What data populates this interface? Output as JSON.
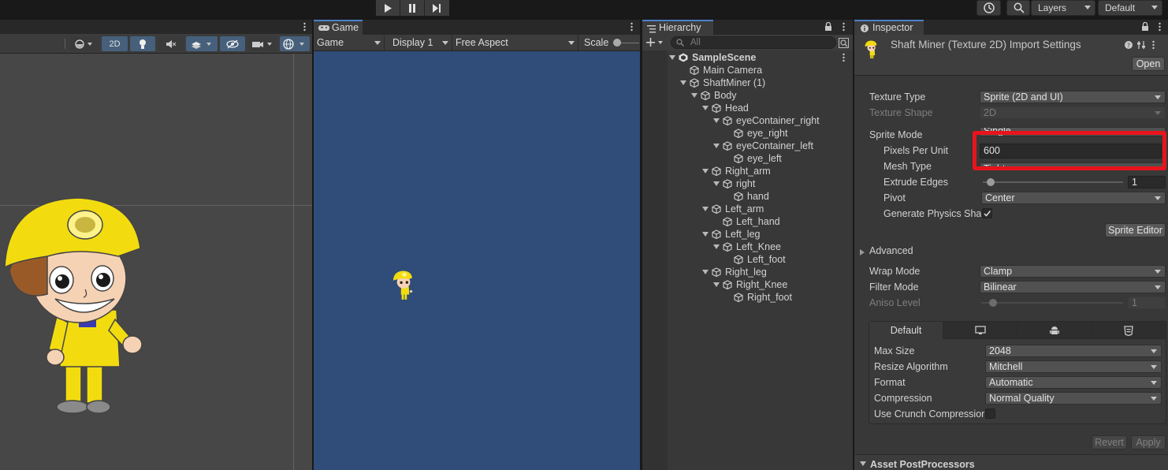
{
  "topbar": {
    "layers_label": "Layers",
    "layout_label": "Default"
  },
  "scene": {
    "mode_2d_label": "2D"
  },
  "game": {
    "tab_title": "Game",
    "view_select": "Game",
    "display_select": "Display 1",
    "aspect_select": "Free Aspect",
    "scale_label": "Scale"
  },
  "hierarchy": {
    "tab_title": "Hierarchy",
    "search_placeholder": "All",
    "items": [
      {
        "label": "SampleScene"
      },
      {
        "label": "Main Camera"
      },
      {
        "label": "ShaftMiner (1)"
      },
      {
        "label": "Body"
      },
      {
        "label": "Head"
      },
      {
        "label": "eyeContainer_right"
      },
      {
        "label": "eye_right"
      },
      {
        "label": "eyeContainer_left"
      },
      {
        "label": "eye_left"
      },
      {
        "label": "Right_arm"
      },
      {
        "label": "right"
      },
      {
        "label": "hand"
      },
      {
        "label": "Left_arm"
      },
      {
        "label": "Left_hand"
      },
      {
        "label": "Left_leg"
      },
      {
        "label": "Left_Knee"
      },
      {
        "label": "Left_foot"
      },
      {
        "label": "Right_leg"
      },
      {
        "label": "Right_Knee"
      },
      {
        "label": "Right_foot"
      }
    ]
  },
  "inspector": {
    "tab_title": "Inspector",
    "header_title": "Shaft Miner (Texture 2D) Import Settings",
    "open_button": "Open",
    "texture_type_label": "Texture Type",
    "texture_type_value": "Sprite (2D and UI)",
    "texture_shape_label": "Texture Shape",
    "texture_shape_value": "2D",
    "sprite_mode_label": "Sprite Mode",
    "sprite_mode_value": "Single",
    "ppu_label": "Pixels Per Unit",
    "ppu_value": "600",
    "mesh_type_label": "Mesh Type",
    "mesh_type_value": "Tight",
    "extrude_label": "Extrude Edges",
    "extrude_value": "1",
    "pivot_label": "Pivot",
    "pivot_value": "Center",
    "physics_label": "Generate Physics Sha",
    "sprite_editor_button": "Sprite Editor",
    "advanced_label": "Advanced",
    "wrap_label": "Wrap Mode",
    "wrap_value": "Clamp",
    "filter_label": "Filter Mode",
    "filter_value": "Bilinear",
    "aniso_label": "Aniso Level",
    "aniso_value": "1",
    "platform_default_tab": "Default",
    "max_size_label": "Max Size",
    "max_size_value": "2048",
    "resize_label": "Resize Algorithm",
    "resize_value": "Mitchell",
    "format_label": "Format",
    "format_value": "Automatic",
    "compression_label": "Compression",
    "compression_value": "Normal Quality",
    "crunch_label": "Use Crunch Compressior",
    "revert_button": "Revert",
    "apply_button": "Apply",
    "postprocessors_label": "Asset PostProcessors"
  },
  "colors": {
    "highlight_box": "#e8141c",
    "game_background": "#2f4d78",
    "panel_background": "#383838"
  }
}
